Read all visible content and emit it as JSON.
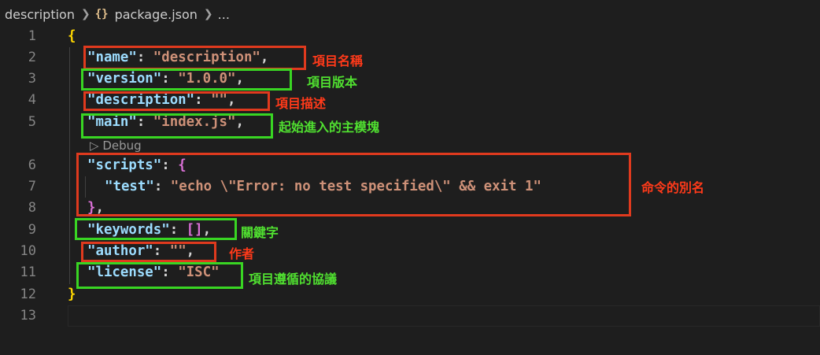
{
  "breadcrumb": {
    "folder": "description",
    "file_icon": "{}",
    "file": "package.json",
    "more": "..."
  },
  "line_numbers": [
    "1",
    "2",
    "3",
    "4",
    "5",
    "6",
    "7",
    "8",
    "9",
    "10",
    "11",
    "12",
    "13"
  ],
  "codelens": {
    "icon": "play-icon",
    "label": "Debug"
  },
  "code": {
    "l1_brace": "{",
    "name_key": "\"name\"",
    "name_value": "\"description\"",
    "version_key": "\"version\"",
    "version_value": "\"1.0.0\"",
    "description_key": "\"description\"",
    "description_value": "\"\"",
    "main_key": "\"main\"",
    "main_value": "\"index.js\"",
    "scripts_key": "\"scripts\"",
    "scripts_open": "{",
    "test_key": "\"test\"",
    "test_value": "\"echo \\\"Error: no test specified\\\" && exit 1\"",
    "scripts_close": "}",
    "keywords_key": "\"keywords\"",
    "keywords_value": "[]",
    "author_key": "\"author\"",
    "author_value": "\"\"",
    "license_key": "\"license\"",
    "license_value": "\"ISC\"",
    "l12_brace": "}",
    "colon": ": ",
    "comma": ","
  },
  "annotations": {
    "name": "項目名稱",
    "version": "項目版本",
    "description": "項目描述",
    "main": "起始進入的主模塊",
    "scripts": "命令的別名",
    "keywords": "關鍵字",
    "author": "作者",
    "license": "項目遵循的協議"
  },
  "colors": {
    "background": "#1e1e1e",
    "key": "#9cdcfe",
    "string": "#ce9178",
    "red_box": "#e03a1e",
    "green_box": "#39d523"
  }
}
